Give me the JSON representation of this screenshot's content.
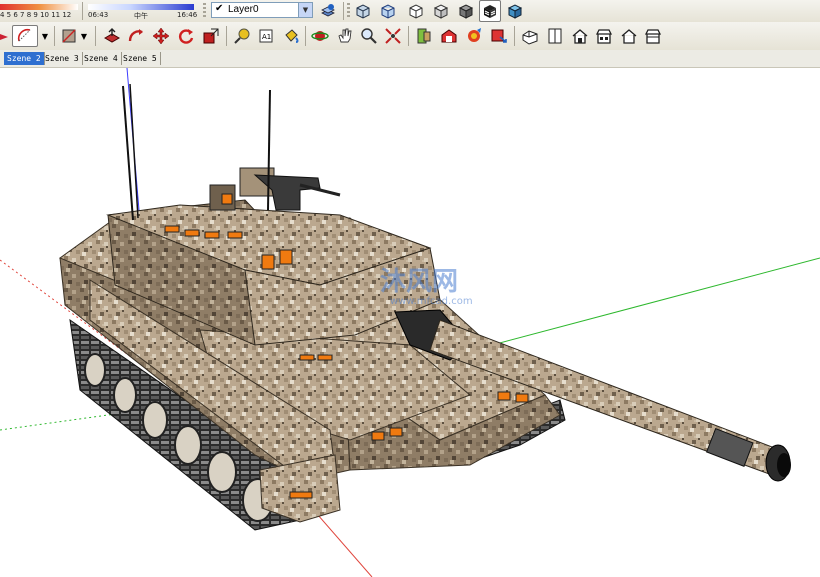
{
  "shadow": {
    "month_ticks": "4 5 6 7 8 9 10 11 12",
    "time_start": "06:43",
    "time_mid": "中午",
    "time_end": "16:46"
  },
  "layer": {
    "current": "Layer0"
  },
  "tabs": [
    {
      "label": "Szene 2",
      "active": true
    },
    {
      "label": "Szene 3",
      "active": false
    },
    {
      "label": "Szene 4",
      "active": false
    },
    {
      "label": "Szene 5",
      "active": false
    }
  ],
  "watermark": {
    "cn": "沐风网",
    "url": "www.mfcad.com"
  },
  "colors": {
    "x_axis": "#e0453c",
    "y_axis": "#2eb82e",
    "z_axis": "#3b3bff",
    "tab_active": "#2f6fd0"
  }
}
